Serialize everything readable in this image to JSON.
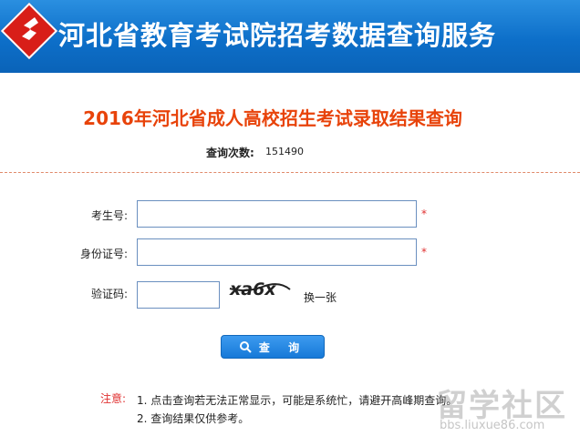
{
  "header": {
    "title": "河北省教育考试院招考数据查询服务"
  },
  "page": {
    "title": "2016年河北省成人高校招生考试录取结果查询",
    "count_label": "查询次数:",
    "count_value": "151490"
  },
  "form": {
    "exam_number": {
      "label": "考生号:",
      "value": "",
      "required_mark": "*"
    },
    "id_number": {
      "label": "身份证号:",
      "value": "",
      "required_mark": "*"
    },
    "captcha": {
      "label": "验证码:",
      "value": "",
      "image_text": "xa6x",
      "refresh_label": "换一张"
    },
    "submit_label": "查 询"
  },
  "notes": {
    "label": "注意:",
    "items": [
      "1. 点击查询若无法正常显示，可能是系统忙，请避开高峰期查询。",
      "2. 查询结果仅供参考。"
    ]
  },
  "watermark": {
    "main": "留学社区",
    "url": "bbs.liuxue86.com"
  },
  "colors": {
    "header_blue": "#0d6fc9",
    "title_orange": "#e8430a",
    "required_red": "#e03030",
    "button_blue": "#1679d8"
  }
}
